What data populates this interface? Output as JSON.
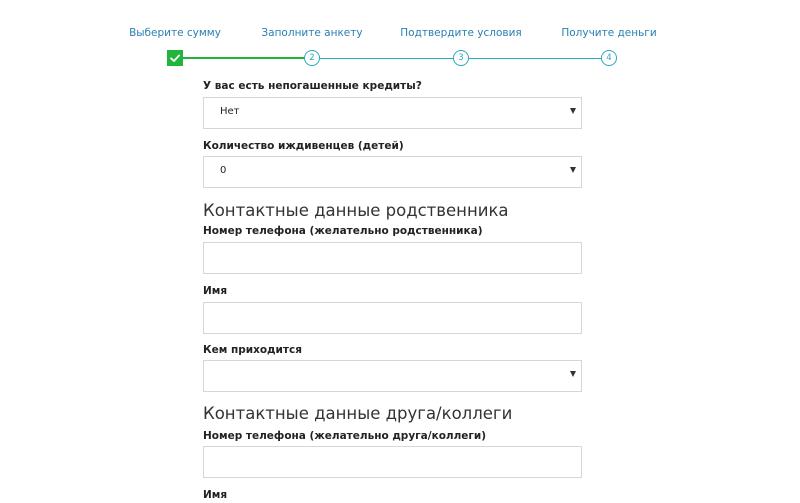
{
  "stepper": {
    "steps": [
      {
        "label": "Выберите сумму",
        "number": "",
        "done": true
      },
      {
        "label": "Заполните анкету",
        "number": "2",
        "done": false
      },
      {
        "label": "Подтвердите условия",
        "number": "3",
        "done": false
      },
      {
        "label": "Получите деньги",
        "number": "4",
        "done": false
      }
    ],
    "accent_done": "#22b53b",
    "accent": "#2aa8bf"
  },
  "form": {
    "credits": {
      "label": "У вас есть непогашенные кредиты?",
      "value": "Нет"
    },
    "dependents": {
      "label": "Количество иждивенцев (детей)",
      "value": "0"
    },
    "relative": {
      "title": "Контактные данные родственника",
      "phone_label": "Номер телефона (желательно родственника)",
      "phone_value": "",
      "name_label": "Имя",
      "name_value": "",
      "relation_label": "Кем приходится",
      "relation_value": ""
    },
    "friend": {
      "title": "Контактные данные друга/коллеги",
      "phone_label": "Номер телефона (желательно друга/коллеги)",
      "phone_value": "",
      "name_label": "Имя"
    }
  }
}
